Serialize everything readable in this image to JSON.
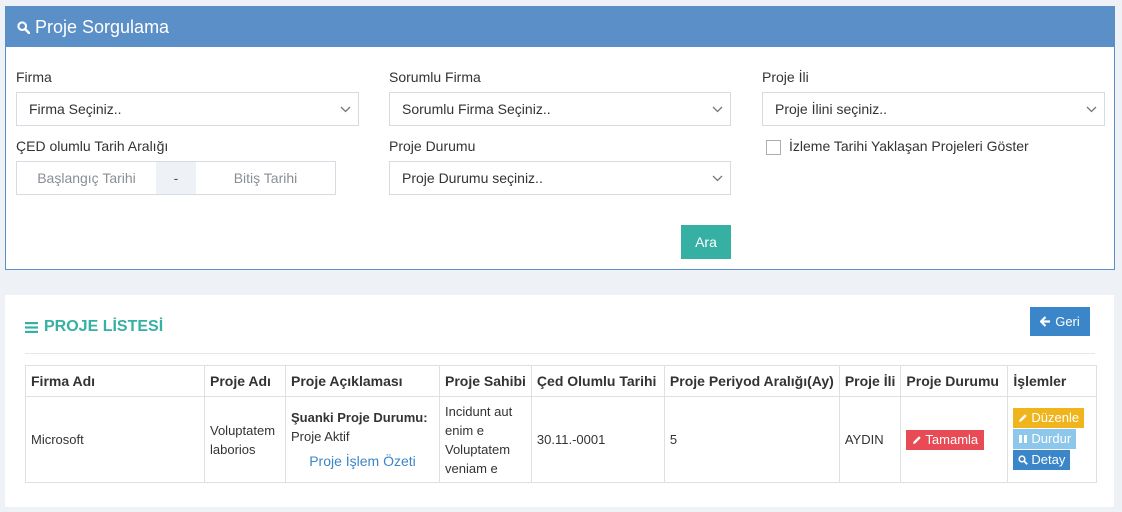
{
  "search_panel": {
    "title": "Proje Sorgulama",
    "firma": {
      "label": "Firma",
      "value": "Firma Seçiniz.."
    },
    "sorumlu_firma": {
      "label": "Sorumlu Firma",
      "value": "Sorumlu Firma Seçiniz.."
    },
    "proje_ili": {
      "label": "Proje İli",
      "value": "Proje İlini seçiniz.."
    },
    "ced_tarih": {
      "label": "ÇED olumlu Tarih Aralığı",
      "start_placeholder": "Başlangıç Tarihi",
      "separator": "-",
      "end_placeholder": "Bitiş Tarihi"
    },
    "proje_durumu": {
      "label": "Proje Durumu",
      "value": "Proje Durumu seçiniz.."
    },
    "izleme_checkbox": {
      "label": "İzleme Tarihi Yaklaşan Projeleri Göster",
      "checked": false
    },
    "search_button": "Ara"
  },
  "list_panel": {
    "title": "PROJE LİSTESİ",
    "back_button": "Geri",
    "columns": [
      "Firma Adı",
      "Proje Adı",
      "Proje Açıklaması",
      "Proje Sahibi",
      "Çed Olumlu Tarihi",
      "Proje Periyod Aralığı(Ay)",
      "Proje İli",
      "Proje Durumu",
      "İşlemler"
    ],
    "rows": [
      {
        "firma_adi": "Microsoft",
        "proje_adi": "Voluptatem laborios",
        "aciklama_label": "Şuanki Proje Durumu:",
        "aciklama_value": "Proje Aktif",
        "aciklama_link": "Proje İşlem Özeti",
        "proje_sahibi": "Incidunt aut enim e Voluptatem veniam e",
        "ced_tarihi": "30.11.-0001",
        "periyod": "5",
        "il": "AYDIN",
        "durum": "Tamamla",
        "actions": {
          "edit": "Düzenle",
          "pause": "Durdur",
          "detail": "Detay"
        }
      }
    ]
  },
  "colors": {
    "header_blue": "#5b8fc7",
    "teal": "#36b0a3",
    "red": "#e94b56",
    "yellow": "#f0b51d",
    "light_blue": "#8ec7ec",
    "blue": "#3a86c8"
  }
}
